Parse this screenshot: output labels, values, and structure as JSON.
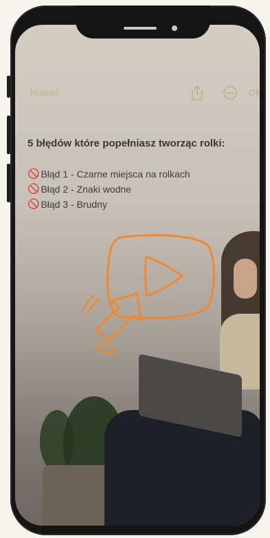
{
  "notes_app": {
    "back_label": "Notatki",
    "done_label": "OK"
  },
  "note": {
    "title": "5 błędów które popełniasz tworząc rolki:",
    "items": [
      {
        "icon": "🚫",
        "text": "Błąd 1 - Czarne miejsca na rolkach"
      },
      {
        "icon": "🚫",
        "text": "Błąd 2 - Znaki wodne"
      },
      {
        "icon": "🚫",
        "text": "Błąd 3 - Brudny"
      }
    ]
  },
  "colors": {
    "accent": "#f08a2c",
    "background": "#f7f3ee",
    "phone": "#151515"
  },
  "icons": [
    "share-icon",
    "more-icon",
    "play-icon",
    "cursor-arrow-icon"
  ]
}
